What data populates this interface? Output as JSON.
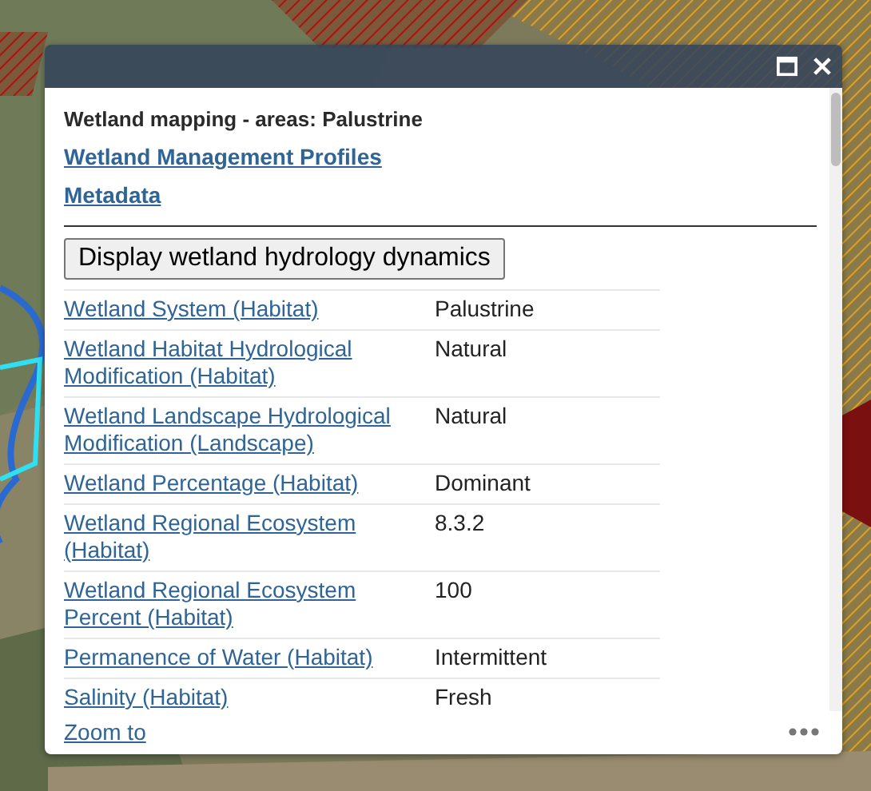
{
  "popup": {
    "title": "Wetland mapping - areas: Palustrine",
    "links": [
      "Wetland Management Profiles",
      "Metadata"
    ],
    "button": "Display wetland hydrology dynamics",
    "attributes": [
      {
        "name": "Wetland System (Habitat)",
        "value": "Palustrine"
      },
      {
        "name": "Wetland Habitat Hydrological Modification (Habitat)",
        "value": "Natural"
      },
      {
        "name": "Wetland Landscape Hydrological Modification (Landscape)",
        "value": "Natural"
      },
      {
        "name": "Wetland Percentage (Habitat)",
        "value": "Dominant"
      },
      {
        "name": "Wetland Regional Ecosystem (Habitat)",
        "value": "8.3.2"
      },
      {
        "name": "Wetland Regional Ecosystem Percent (Habitat)",
        "value": "100"
      },
      {
        "name": "Permanence of Water (Habitat)",
        "value": "Intermittent"
      },
      {
        "name": "Salinity (Habitat)",
        "value": "Fresh"
      }
    ],
    "footer_link": "Zoom to"
  }
}
